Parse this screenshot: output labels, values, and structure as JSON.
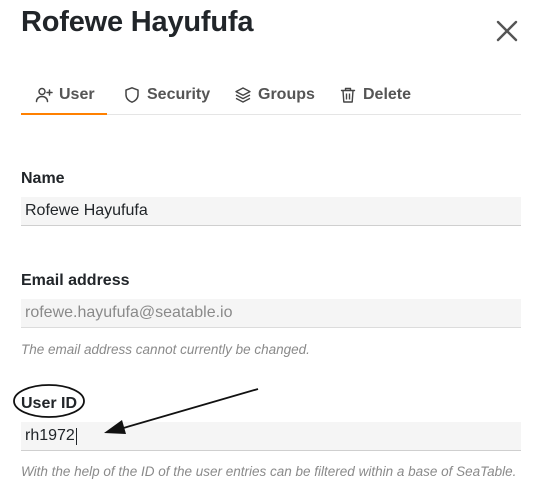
{
  "dialog": {
    "title": "Rofewe Hayufufa",
    "close_icon": "close-icon"
  },
  "tabs": [
    {
      "label": "User",
      "icon": "user-plus-icon",
      "active": true
    },
    {
      "label": "Security",
      "icon": "shield-icon",
      "active": false
    },
    {
      "label": "Groups",
      "icon": "layers-icon",
      "active": false
    },
    {
      "label": "Delete",
      "icon": "trash-icon",
      "active": false
    }
  ],
  "form": {
    "name": {
      "label": "Name",
      "value": "Rofewe Hayufufa"
    },
    "email": {
      "label": "Email address",
      "value": "rofewe.hayufufa@seatable.io",
      "help": "The email address cannot currently be changed."
    },
    "user_id": {
      "label": "User ID",
      "value": "rh1972",
      "help": "With the help of the ID of the user entries can be filtered within a base of SeaTable."
    }
  },
  "colors": {
    "accent": "#ff8000",
    "text": "#212529",
    "muted": "#8a8a8a",
    "field_bg": "#f5f5f5"
  }
}
